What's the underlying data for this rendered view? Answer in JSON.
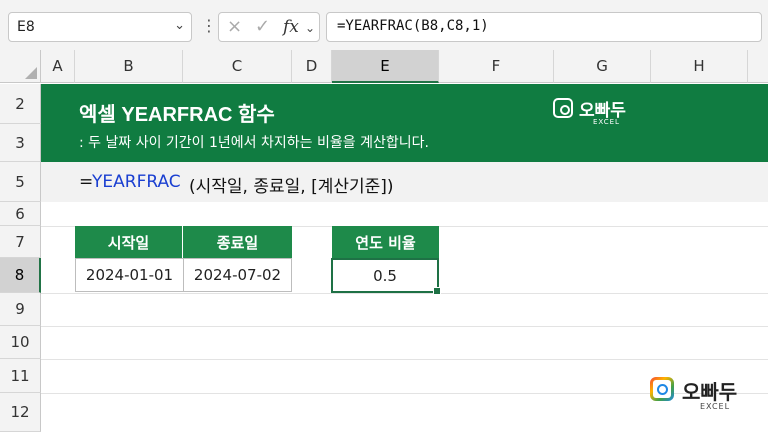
{
  "formula_bar": {
    "name_box": "E8",
    "formula": "=YEARFRAC(B8,C8,1)",
    "cancel_icon": "×",
    "enter_icon": "✓",
    "fx_label": "fx"
  },
  "columns": [
    "A",
    "B",
    "C",
    "D",
    "E",
    "F",
    "G",
    "H"
  ],
  "rows": [
    "2",
    "3",
    "5",
    "6",
    "7",
    "8",
    "9",
    "10",
    "11",
    "12"
  ],
  "banner": {
    "title": "엑셀 YEARFRAC 함수",
    "subtitle": ": 두 날짜 사이 기간이 1년에서 차지하는 비율을 계산합니다.",
    "logo_name": "오빠두",
    "logo_sub": "EXCEL"
  },
  "syntax": {
    "prefix": "=",
    "func": "YEARFRAC",
    "args": "(시작일, 종료일, [계산기준])"
  },
  "table": {
    "headers": [
      "시작일",
      "종료일"
    ],
    "values": [
      "2024-01-01",
      "2024-07-02"
    ]
  },
  "result": {
    "header": "연도 비율",
    "value": "0.5"
  },
  "watermark": {
    "name": "오빠두",
    "sub": "EXCEL"
  },
  "colors": {
    "accent": "#107c41",
    "header_green": "#1e8a4a",
    "function_blue": "#1a3fd1"
  }
}
